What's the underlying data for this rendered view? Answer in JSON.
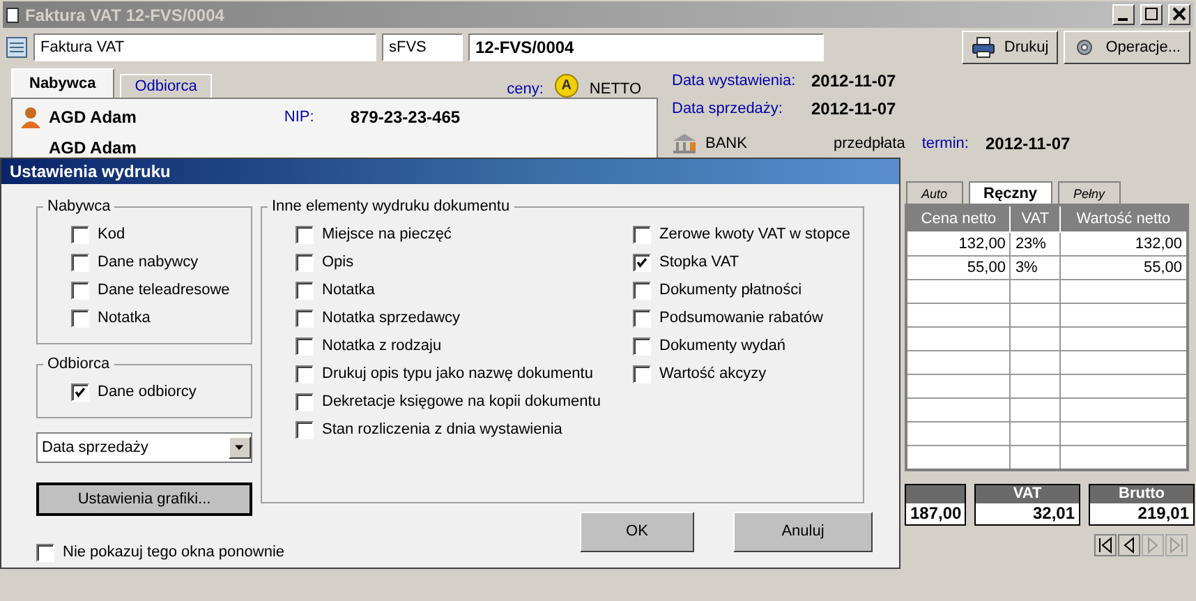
{
  "window": {
    "title": "Faktura VAT 12-FVS/0004"
  },
  "toolbar": {
    "doc_type": "Faktura VAT",
    "series": "sFVS",
    "number": "12-FVS/0004",
    "buttons": [
      {
        "kind": "print",
        "label": "Drukuj"
      },
      {
        "kind": "gear",
        "label": "Operacje..."
      }
    ]
  },
  "party_tabs": [
    {
      "label": "Nabywca",
      "selected": true
    },
    {
      "label": "Odbiorca",
      "selected": false
    }
  ],
  "prices": {
    "label": "ceny:",
    "badge": "A",
    "mode": "NETTO"
  },
  "buyer": {
    "name": "AGD Adam",
    "nip_label": "NIP:",
    "nip": "879-23-23-465",
    "name_2": "AGD Adam"
  },
  "dates": [
    {
      "label": "Data wystawienia:",
      "value": "2012-11-07"
    },
    {
      "label": "Data sprzedaży:",
      "value": "2012-11-07"
    }
  ],
  "payment": {
    "method": "BANK",
    "type": "przedpłata",
    "term_label": "termin:",
    "term": "2012-11-07"
  },
  "vat_tabs": [
    {
      "label": "Auto",
      "selected": false
    },
    {
      "label": "Ręczny",
      "selected": true
    },
    {
      "label": "Pełny",
      "selected": false
    }
  ],
  "table": {
    "columns": [
      "Cena netto",
      "VAT",
      "Wartość netto"
    ],
    "rows": [
      [
        "132,00",
        "23%",
        "132,00"
      ],
      [
        "55,00",
        "3%",
        "55,00"
      ]
    ]
  },
  "totals": [
    {
      "value": "187,00"
    },
    {
      "label": "VAT",
      "value": "32,01"
    },
    {
      "label": "Brutto",
      "value": "219,01"
    }
  ],
  "dialog": {
    "title": "Ustawienia wydruku",
    "buyer_group": {
      "title": "Nabywca",
      "options": [
        {
          "label": "Kod",
          "checked": false
        },
        {
          "label": "Dane nabywcy",
          "checked": false
        },
        {
          "label": "Dane teleadresowe",
          "checked": false
        },
        {
          "label": "Notatka",
          "checked": false
        }
      ]
    },
    "recipient_group": {
      "title": "Odbiorca",
      "options": [
        {
          "label": "Dane odbiorcy",
          "checked": true
        }
      ]
    },
    "date_select": {
      "value": "Data sprzedaży"
    },
    "graphics_button": "Ustawienia grafiki...",
    "other_group": {
      "title": "Inne elementy wydruku dokumentu",
      "columns": [
        [
          {
            "label": "Miejsce na pieczęć",
            "checked": false
          },
          {
            "label": "Opis",
            "checked": false
          },
          {
            "label": "Notatka",
            "checked": false
          },
          {
            "label": "Notatka sprzedawcy",
            "checked": false
          },
          {
            "label": "Notatka z rodzaju",
            "checked": false
          },
          {
            "label": "Drukuj opis typu jako nazwę dokumentu",
            "checked": false
          },
          {
            "label": "Dekretacje księgowe na kopii dokumentu",
            "checked": false
          },
          {
            "label": "Stan rozliczenia z dnia wystawienia",
            "checked": false
          }
        ],
        [
          {
            "label": "Zerowe kwoty VAT w stopce",
            "checked": false
          },
          {
            "label": "Stopka VAT",
            "checked": true
          },
          {
            "label": "Dokumenty płatności",
            "checked": false
          },
          {
            "label": "Podsumowanie rabatów",
            "checked": false
          },
          {
            "label": "Dokumenty wydań",
            "checked": false
          },
          {
            "label": "Wartość akcyzy",
            "checked": false
          }
        ]
      ]
    },
    "dont_show": {
      "label": "Nie pokazuj tego okna ponownie",
      "checked": false
    },
    "buttons": [
      "OK",
      "Anuluj"
    ]
  }
}
